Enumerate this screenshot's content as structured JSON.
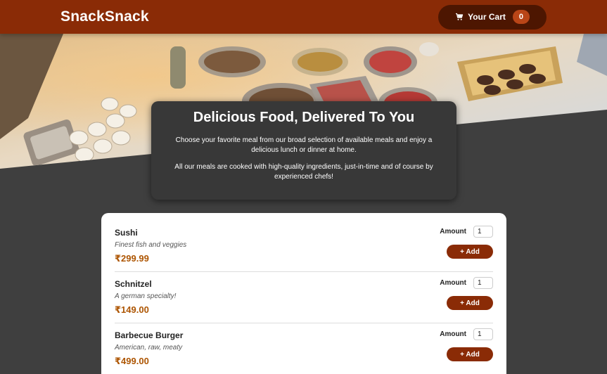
{
  "header": {
    "brand": "SnackSnack",
    "cart_label": "Your Cart",
    "cart_count": "0"
  },
  "summary": {
    "title": "Delicious Food, Delivered To You",
    "paragraph1": "Choose your favorite meal from our broad selection of available meals and enjoy a delicious lunch or dinner at home.",
    "paragraph2": "All our meals are cooked with high-quality ingredients, just-in-time and of course by experienced chefs!"
  },
  "meals": [
    {
      "name": "Sushi",
      "description": "Finest fish and veggies",
      "price": "₹299.99",
      "amount_label": "Amount",
      "amount": "1",
      "add_label": "+ Add"
    },
    {
      "name": "Schnitzel",
      "description": "A german specialty!",
      "price": "₹149.00",
      "amount_label": "Amount",
      "amount": "1",
      "add_label": "+ Add"
    },
    {
      "name": "Barbecue Burger",
      "description": "American, raw, meaty",
      "price": "₹499.00",
      "amount_label": "Amount",
      "amount": "1",
      "add_label": "+ Add"
    }
  ],
  "colors": {
    "header": "#8a2b06",
    "cart_button": "#4d1601",
    "badge": "#b94517",
    "price": "#ad5502",
    "background": "#3f3f3f"
  },
  "icons": {
    "cart": "shopping-cart-icon"
  }
}
